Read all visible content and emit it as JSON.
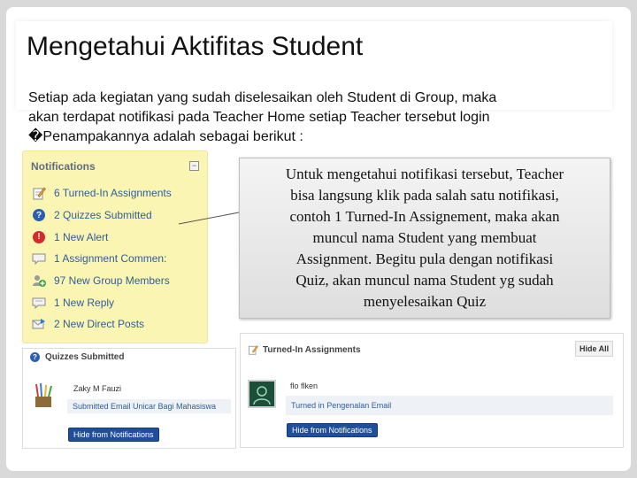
{
  "slide": {
    "title": "Mengetahui Aktifitas Student",
    "intro_lines": [
      "Setiap ada kegiatan yang sudah diselesaikan oleh Student di Group,  maka",
      "akan terdapat notifikasi pada Teacher Home setiap Teacher tersebut login",
      "�Penampakannya adalah sebagai berikut :"
    ],
    "callout_lines": [
      "Untuk mengetahui notifikasi tersebut, Teacher",
      "bisa langsung klik pada salah satu notifikasi,",
      "contoh 1 Turned-In  Assignement, maka akan",
      "muncul nama Student yang membuat",
      "Assignment. Begitu pula dengan notifikasi",
      "Quiz,  akan muncul nama Student yg sudah",
      "menyelesaikan Quiz"
    ]
  },
  "notifications": {
    "header": "Notifications",
    "collapse_symbol": "−",
    "items": [
      {
        "label": "6 Turned-In Assignments",
        "icon": "pencil-paper-icon"
      },
      {
        "label": "2 Quizzes Submitted",
        "icon": "question-icon"
      },
      {
        "label": "1 New Alert",
        "icon": "alert-icon"
      },
      {
        "label": "1 Assignment Commen:",
        "icon": "comment-icon"
      },
      {
        "label": "97 New Group Members",
        "icon": "group-members-icon"
      },
      {
        "label": "1 New Reply",
        "icon": "reply-icon"
      },
      {
        "label": "2 New Direct Posts",
        "icon": "direct-post-icon"
      }
    ]
  },
  "quizzes_panel": {
    "title": "Quizzes Submitted",
    "student_name": "Zaky M Fauzi",
    "submission": "Submitted Email Unicar Bagi Mahasiswa",
    "hide_button": "Hide from Notifications"
  },
  "turned_in_panel": {
    "title": "Turned-In Assignments",
    "hide_all_button": "Hide All",
    "student_name": "flo flken",
    "submission": "Turned in Pengenalan Email",
    "hide_button": "Hide from Notifications"
  },
  "colors": {
    "notification_panel_bg": "#fbf5b4",
    "link_blue": "#2f5e9a",
    "button_blue": "#1f4f9b",
    "callout_bg": "#ececec"
  }
}
